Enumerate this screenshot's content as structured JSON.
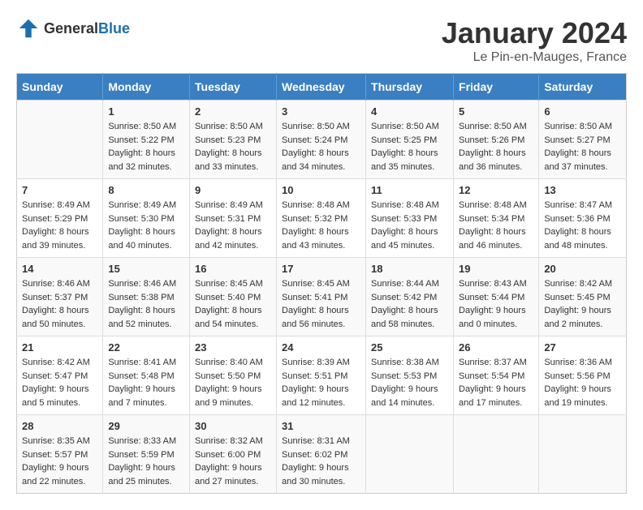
{
  "logo": {
    "text_general": "General",
    "text_blue": "Blue"
  },
  "title": {
    "month_year": "January 2024",
    "location": "Le Pin-en-Mauges, France"
  },
  "weekdays": [
    "Sunday",
    "Monday",
    "Tuesday",
    "Wednesday",
    "Thursday",
    "Friday",
    "Saturday"
  ],
  "weeks": [
    [
      {
        "day": "",
        "sunrise": "",
        "sunset": "",
        "daylight": ""
      },
      {
        "day": "1",
        "sunrise": "Sunrise: 8:50 AM",
        "sunset": "Sunset: 5:22 PM",
        "daylight": "Daylight: 8 hours and 32 minutes."
      },
      {
        "day": "2",
        "sunrise": "Sunrise: 8:50 AM",
        "sunset": "Sunset: 5:23 PM",
        "daylight": "Daylight: 8 hours and 33 minutes."
      },
      {
        "day": "3",
        "sunrise": "Sunrise: 8:50 AM",
        "sunset": "Sunset: 5:24 PM",
        "daylight": "Daylight: 8 hours and 34 minutes."
      },
      {
        "day": "4",
        "sunrise": "Sunrise: 8:50 AM",
        "sunset": "Sunset: 5:25 PM",
        "daylight": "Daylight: 8 hours and 35 minutes."
      },
      {
        "day": "5",
        "sunrise": "Sunrise: 8:50 AM",
        "sunset": "Sunset: 5:26 PM",
        "daylight": "Daylight: 8 hours and 36 minutes."
      },
      {
        "day": "6",
        "sunrise": "Sunrise: 8:50 AM",
        "sunset": "Sunset: 5:27 PM",
        "daylight": "Daylight: 8 hours and 37 minutes."
      }
    ],
    [
      {
        "day": "7",
        "sunrise": "Sunrise: 8:49 AM",
        "sunset": "Sunset: 5:29 PM",
        "daylight": "Daylight: 8 hours and 39 minutes."
      },
      {
        "day": "8",
        "sunrise": "Sunrise: 8:49 AM",
        "sunset": "Sunset: 5:30 PM",
        "daylight": "Daylight: 8 hours and 40 minutes."
      },
      {
        "day": "9",
        "sunrise": "Sunrise: 8:49 AM",
        "sunset": "Sunset: 5:31 PM",
        "daylight": "Daylight: 8 hours and 42 minutes."
      },
      {
        "day": "10",
        "sunrise": "Sunrise: 8:48 AM",
        "sunset": "Sunset: 5:32 PM",
        "daylight": "Daylight: 8 hours and 43 minutes."
      },
      {
        "day": "11",
        "sunrise": "Sunrise: 8:48 AM",
        "sunset": "Sunset: 5:33 PM",
        "daylight": "Daylight: 8 hours and 45 minutes."
      },
      {
        "day": "12",
        "sunrise": "Sunrise: 8:48 AM",
        "sunset": "Sunset: 5:34 PM",
        "daylight": "Daylight: 8 hours and 46 minutes."
      },
      {
        "day": "13",
        "sunrise": "Sunrise: 8:47 AM",
        "sunset": "Sunset: 5:36 PM",
        "daylight": "Daylight: 8 hours and 48 minutes."
      }
    ],
    [
      {
        "day": "14",
        "sunrise": "Sunrise: 8:46 AM",
        "sunset": "Sunset: 5:37 PM",
        "daylight": "Daylight: 8 hours and 50 minutes."
      },
      {
        "day": "15",
        "sunrise": "Sunrise: 8:46 AM",
        "sunset": "Sunset: 5:38 PM",
        "daylight": "Daylight: 8 hours and 52 minutes."
      },
      {
        "day": "16",
        "sunrise": "Sunrise: 8:45 AM",
        "sunset": "Sunset: 5:40 PM",
        "daylight": "Daylight: 8 hours and 54 minutes."
      },
      {
        "day": "17",
        "sunrise": "Sunrise: 8:45 AM",
        "sunset": "Sunset: 5:41 PM",
        "daylight": "Daylight: 8 hours and 56 minutes."
      },
      {
        "day": "18",
        "sunrise": "Sunrise: 8:44 AM",
        "sunset": "Sunset: 5:42 PM",
        "daylight": "Daylight: 8 hours and 58 minutes."
      },
      {
        "day": "19",
        "sunrise": "Sunrise: 8:43 AM",
        "sunset": "Sunset: 5:44 PM",
        "daylight": "Daylight: 9 hours and 0 minutes."
      },
      {
        "day": "20",
        "sunrise": "Sunrise: 8:42 AM",
        "sunset": "Sunset: 5:45 PM",
        "daylight": "Daylight: 9 hours and 2 minutes."
      }
    ],
    [
      {
        "day": "21",
        "sunrise": "Sunrise: 8:42 AM",
        "sunset": "Sunset: 5:47 PM",
        "daylight": "Daylight: 9 hours and 5 minutes."
      },
      {
        "day": "22",
        "sunrise": "Sunrise: 8:41 AM",
        "sunset": "Sunset: 5:48 PM",
        "daylight": "Daylight: 9 hours and 7 minutes."
      },
      {
        "day": "23",
        "sunrise": "Sunrise: 8:40 AM",
        "sunset": "Sunset: 5:50 PM",
        "daylight": "Daylight: 9 hours and 9 minutes."
      },
      {
        "day": "24",
        "sunrise": "Sunrise: 8:39 AM",
        "sunset": "Sunset: 5:51 PM",
        "daylight": "Daylight: 9 hours and 12 minutes."
      },
      {
        "day": "25",
        "sunrise": "Sunrise: 8:38 AM",
        "sunset": "Sunset: 5:53 PM",
        "daylight": "Daylight: 9 hours and 14 minutes."
      },
      {
        "day": "26",
        "sunrise": "Sunrise: 8:37 AM",
        "sunset": "Sunset: 5:54 PM",
        "daylight": "Daylight: 9 hours and 17 minutes."
      },
      {
        "day": "27",
        "sunrise": "Sunrise: 8:36 AM",
        "sunset": "Sunset: 5:56 PM",
        "daylight": "Daylight: 9 hours and 19 minutes."
      }
    ],
    [
      {
        "day": "28",
        "sunrise": "Sunrise: 8:35 AM",
        "sunset": "Sunset: 5:57 PM",
        "daylight": "Daylight: 9 hours and 22 minutes."
      },
      {
        "day": "29",
        "sunrise": "Sunrise: 8:33 AM",
        "sunset": "Sunset: 5:59 PM",
        "daylight": "Daylight: 9 hours and 25 minutes."
      },
      {
        "day": "30",
        "sunrise": "Sunrise: 8:32 AM",
        "sunset": "Sunset: 6:00 PM",
        "daylight": "Daylight: 9 hours and 27 minutes."
      },
      {
        "day": "31",
        "sunrise": "Sunrise: 8:31 AM",
        "sunset": "Sunset: 6:02 PM",
        "daylight": "Daylight: 9 hours and 30 minutes."
      },
      {
        "day": "",
        "sunrise": "",
        "sunset": "",
        "daylight": ""
      },
      {
        "day": "",
        "sunrise": "",
        "sunset": "",
        "daylight": ""
      },
      {
        "day": "",
        "sunrise": "",
        "sunset": "",
        "daylight": ""
      }
    ]
  ]
}
